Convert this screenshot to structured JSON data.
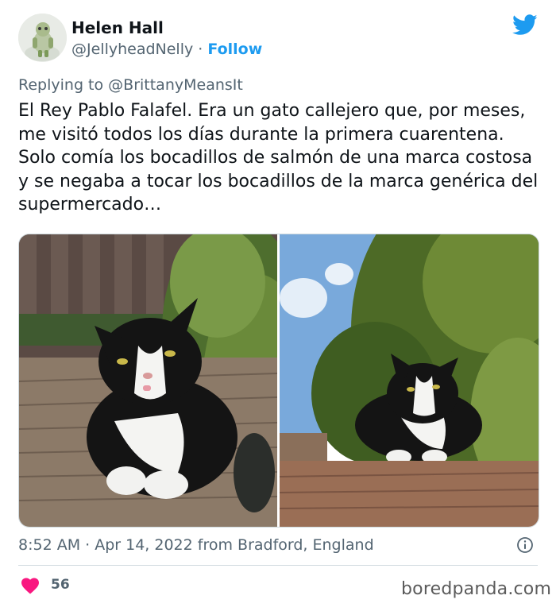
{
  "author": {
    "name": "Helen Hall",
    "handle": "@JellyheadNelly",
    "separator": " · ",
    "follow_label": "Follow",
    "avatar_icon": "avatar-photo"
  },
  "reply": {
    "text": "Replying to @BrittanyMeansIt"
  },
  "tweet": {
    "text": "El Rey Pablo Falafel. Era un gato callejero que, por meses, me visitó todos los días durante la primera cuarentena. Solo comía los bocadillos de salmón de una marca costosa y se negaba a tocar los bocadillos de la marca genérica del supermercado…"
  },
  "meta": {
    "timestamp": "8:52 AM · Apr 14, 2022 from Bradford, England",
    "likes": "56"
  },
  "icons": {
    "brand": "twitter-bird-icon",
    "info": "info-icon",
    "like": "heart-icon"
  },
  "colors": {
    "accent": "#1d9bf0",
    "heart": "#f91880",
    "secondary_text": "#536471",
    "primary_text": "#0f1419"
  },
  "watermark": "boredpanda.com"
}
